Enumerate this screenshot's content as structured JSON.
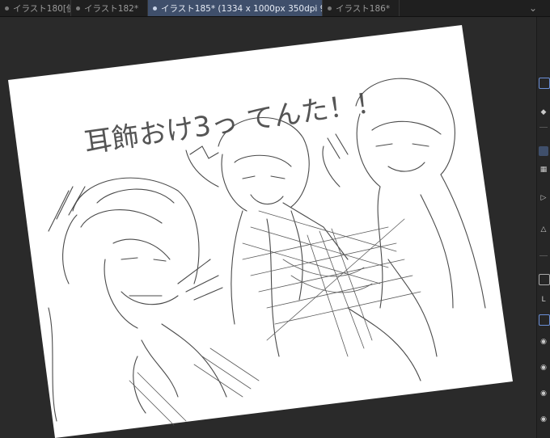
{
  "tabs": [
    {
      "label": "イラスト180[使",
      "active": false
    },
    {
      "label": "イラスト182*",
      "active": false
    },
    {
      "label": "イラスト185* (1334 x 1000px 350dpi 95.1%)",
      "active": true
    },
    {
      "label": "イラスト186*",
      "active": false
    }
  ],
  "canvas": {
    "sketch_title": "耳飾おけ3っ てんた！！"
  },
  "colors": {
    "tab_active_bg": "#3f4f6b",
    "panel_bg": "#2b2b2b",
    "paper": "#ffffff",
    "sketch_stroke": "#444444"
  },
  "icons": [
    "tab-dot-icon",
    "chevron-down-icon",
    "eye-icon",
    "layer-icon"
  ]
}
